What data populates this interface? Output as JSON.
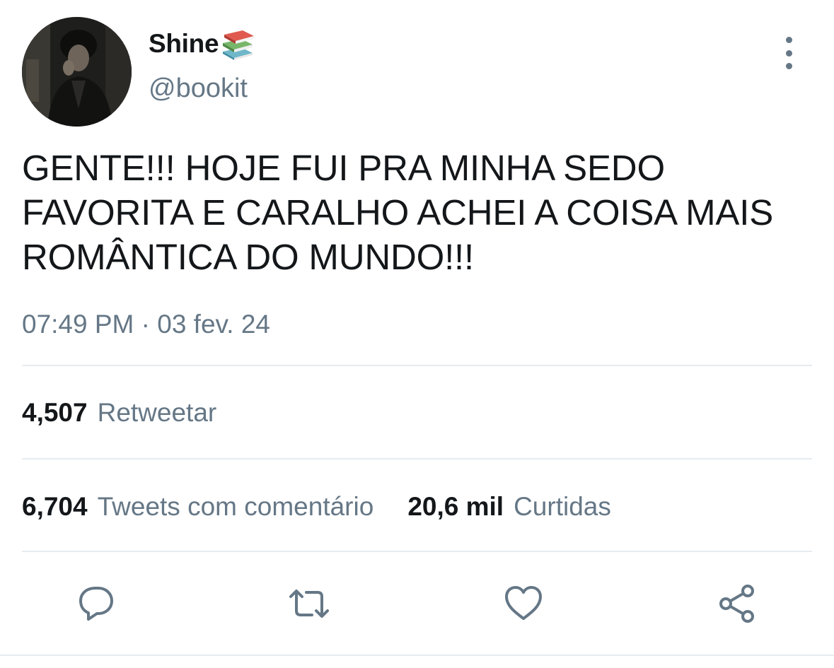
{
  "user": {
    "display_name": "Shine",
    "name_emoji": "books-icon",
    "handle": "@bookit",
    "avatar": "avatar-photo"
  },
  "tweet": {
    "text": "GENTE!!! HOJE FUI PRA MINHA SEDO FAVORITA E CARALHO ACHEI A COISA MAIS ROMÂNTICA DO MUNDO!!!",
    "timestamp": "07:49 PM · 03 fev. 24"
  },
  "stats": {
    "retweets": {
      "count": "4,507",
      "label": "Retweetar"
    },
    "quote_tweets": {
      "count": "6,704",
      "label": "Tweets com comentário"
    },
    "likes": {
      "count": "20,6 mil",
      "label": "Curtidas"
    }
  },
  "actions": [
    {
      "name": "reply",
      "icon": "reply-icon"
    },
    {
      "name": "retweet",
      "icon": "retweet-icon"
    },
    {
      "name": "like",
      "icon": "heart-icon"
    },
    {
      "name": "share",
      "icon": "share-icon"
    }
  ],
  "colors": {
    "text_primary": "#14171a",
    "text_secondary": "#657786",
    "divider": "#e6ecf0",
    "background": "#ffffff"
  }
}
